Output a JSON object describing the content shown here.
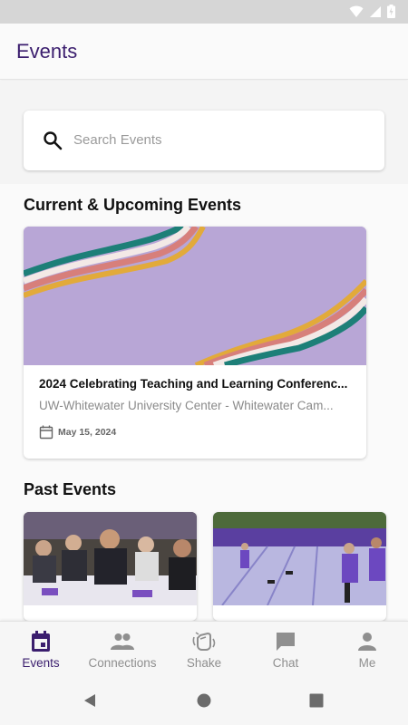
{
  "app": {
    "title": "Events"
  },
  "search": {
    "placeholder": "Search Events"
  },
  "sections": {
    "current": "Current & Upcoming Events",
    "past": "Past Events"
  },
  "current_events": [
    {
      "title": "2024 Celebrating Teaching and Learning Conferenc...",
      "location": "UW-Whitewater University Center - Whitewater Cam...",
      "date": "May 15, 2024"
    }
  ],
  "nav": [
    {
      "label": "Events",
      "icon": "calendar-icon",
      "active": true
    },
    {
      "label": "Connections",
      "icon": "people-icon",
      "active": false
    },
    {
      "label": "Shake",
      "icon": "shake-hand-icon",
      "active": false
    },
    {
      "label": "Chat",
      "icon": "chat-icon",
      "active": false
    },
    {
      "label": "Me",
      "icon": "person-icon",
      "active": false
    }
  ],
  "colors": {
    "brand": "#3b1e6e",
    "banner": "#b8a6d6",
    "inactive": "#8f8f8f"
  }
}
